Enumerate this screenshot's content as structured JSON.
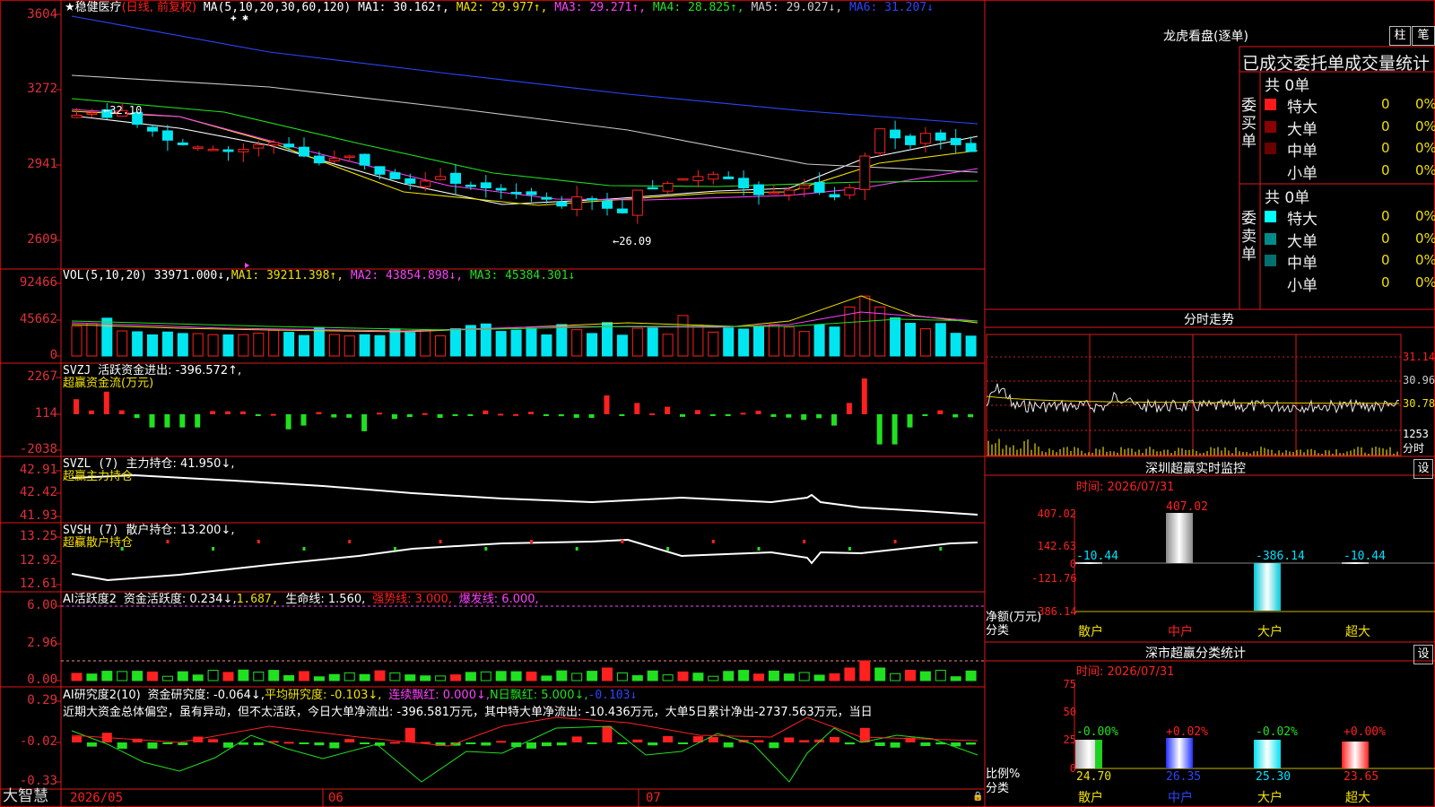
{
  "stock": {
    "star": "★",
    "name": "稳健医疗",
    "period": "(日线, 前复权)",
    "ma_label": "MA(5,10,20,30,60,120)",
    "ma1": "MA1: 30.162↑,",
    "ma2": "MA2: 29.977↑,",
    "ma3": "MA3: 29.271↑,",
    "ma4": "MA4: 28.825↑,",
    "ma5": "MA5: 29.027↓,",
    "ma6": "MA6: 31.207↓",
    "plus_marks": "✚ ✱",
    "high_note": "←32.10",
    "low_note": "←26.09"
  },
  "price_axis": [
    "3604",
    "3272",
    "2941",
    "2609"
  ],
  "vol": {
    "label": "VOL(5,10,20)",
    "value": "33971.000↓,",
    "ma1": "MA1: 39211.398↑,",
    "ma2": "MA2: 43854.898↓,",
    "ma3": "MA3: 45384.301↓",
    "axis": [
      "92466",
      "45662",
      "0"
    ]
  },
  "svzj": {
    "label": "SVZJ",
    "title": "活跃资金进出: -396.572↑,",
    "sub": "超赢资金流(万元)",
    "axis": [
      "2267",
      "114",
      "-2038"
    ]
  },
  "svzl": {
    "label": "SVZL (7)",
    "title": "主力持仓: 41.950↓,",
    "sub": "超赢主力持仓",
    "axis": [
      "42.91",
      "42.42",
      "41.93"
    ]
  },
  "svsh": {
    "label": "SVSH (7)",
    "title": "散户持仓: 13.200↓,",
    "sub": "超赢散户持仓",
    "axis": [
      "13.25",
      "12.92",
      "12.61"
    ]
  },
  "ai1": {
    "label": "AI活跃度2",
    "title": "资金活跃度: 0.234↓,",
    "v2": "1.687,",
    "life": "生命线: 1.560,",
    "strong": "强势线: 3.000,",
    "burst": "爆发线: 6.000,",
    "axis": [
      "6.00",
      "2.96",
      "0.00"
    ]
  },
  "ai2": {
    "label": "AI研究度2(10)",
    "title": "资金研究度: -0.064↓,",
    "avg": "平均研究度: -0.103↓,",
    "cont": "连续飘红: 0.000↓,",
    "nday": "N日飘红: 5.000↓,",
    "last": "-0.103↓",
    "comment": "近期大资金总体偏空，虽有异动，但不太活跃，今日大单净流出: -396.581万元，其中特大单净流出: -10.436万元，大单5日累计净出-2737.563万元，当日",
    "axis": [
      "0.29",
      "-0.02",
      "-0.33"
    ]
  },
  "dates": {
    "d1": "2026/05",
    "d2": "06",
    "d3": "07",
    "brand": "大智慧"
  },
  "right": {
    "lhb_title": "龙虎看盘(逐单)",
    "tab1": "柱",
    "tab2": "笔",
    "header": "已成交委托单成交量统计",
    "buy": {
      "vlabel": "委买单",
      "total": "共 0单",
      "rows": [
        {
          "name": "特大",
          "count": "0",
          "pct": "0%",
          "color": "#ff1a1a"
        },
        {
          "name": "大单",
          "count": "0",
          "pct": "0%",
          "color": "#8b0000"
        },
        {
          "name": "中单",
          "count": "0",
          "pct": "0%",
          "color": "#6b0000"
        },
        {
          "name": "小单",
          "count": "0",
          "pct": "0%",
          "color": "#000000"
        }
      ]
    },
    "sell": {
      "vlabel": "委卖单",
      "total": "共 0单",
      "rows": [
        {
          "name": "特大",
          "count": "0",
          "pct": "0%",
          "color": "#00ffff"
        },
        {
          "name": "大单",
          "count": "0",
          "pct": "0%",
          "color": "#008b8b"
        },
        {
          "name": "中单",
          "count": "0",
          "pct": "0%",
          "color": "#007070"
        },
        {
          "name": "小单",
          "count": "0",
          "pct": "0%",
          "color": "#000000"
        }
      ]
    },
    "fsz_title": "分时走势",
    "fsz_axis": [
      "31.14",
      "30.96",
      "30.78",
      "1253",
      "分时"
    ],
    "sz_title": "深圳超赢实时监控",
    "sz_time": "时间: 2026/07/31",
    "sz_set": "设",
    "sz_axis": [
      "407.02",
      "142.63",
      "0",
      "-121.76",
      "-386.14"
    ],
    "sz_unit": "净额(万元)",
    "sz_cat": "分类",
    "sz_values": [
      "-10.44",
      "407.02",
      "-386.14",
      "-10.44"
    ],
    "sz_cats": [
      "散户",
      "中户",
      "大户",
      "超大"
    ],
    "fl_title": "深市超赢分类统计",
    "fl_time": "时间: 2026/07/31",
    "fl_set": "设",
    "fl_axis": [
      "75",
      "50",
      "25",
      "0"
    ],
    "fl_unit": "比例%",
    "fl_cat": "分类",
    "fl_changes": [
      "-0.00%",
      "+0.02%",
      "-0.02%",
      "+0.00%"
    ],
    "fl_values": [
      "24.70",
      "26.35",
      "25.30",
      "23.65"
    ],
    "fl_cats": [
      "散户",
      "中户",
      "大户",
      "超大"
    ]
  }
}
